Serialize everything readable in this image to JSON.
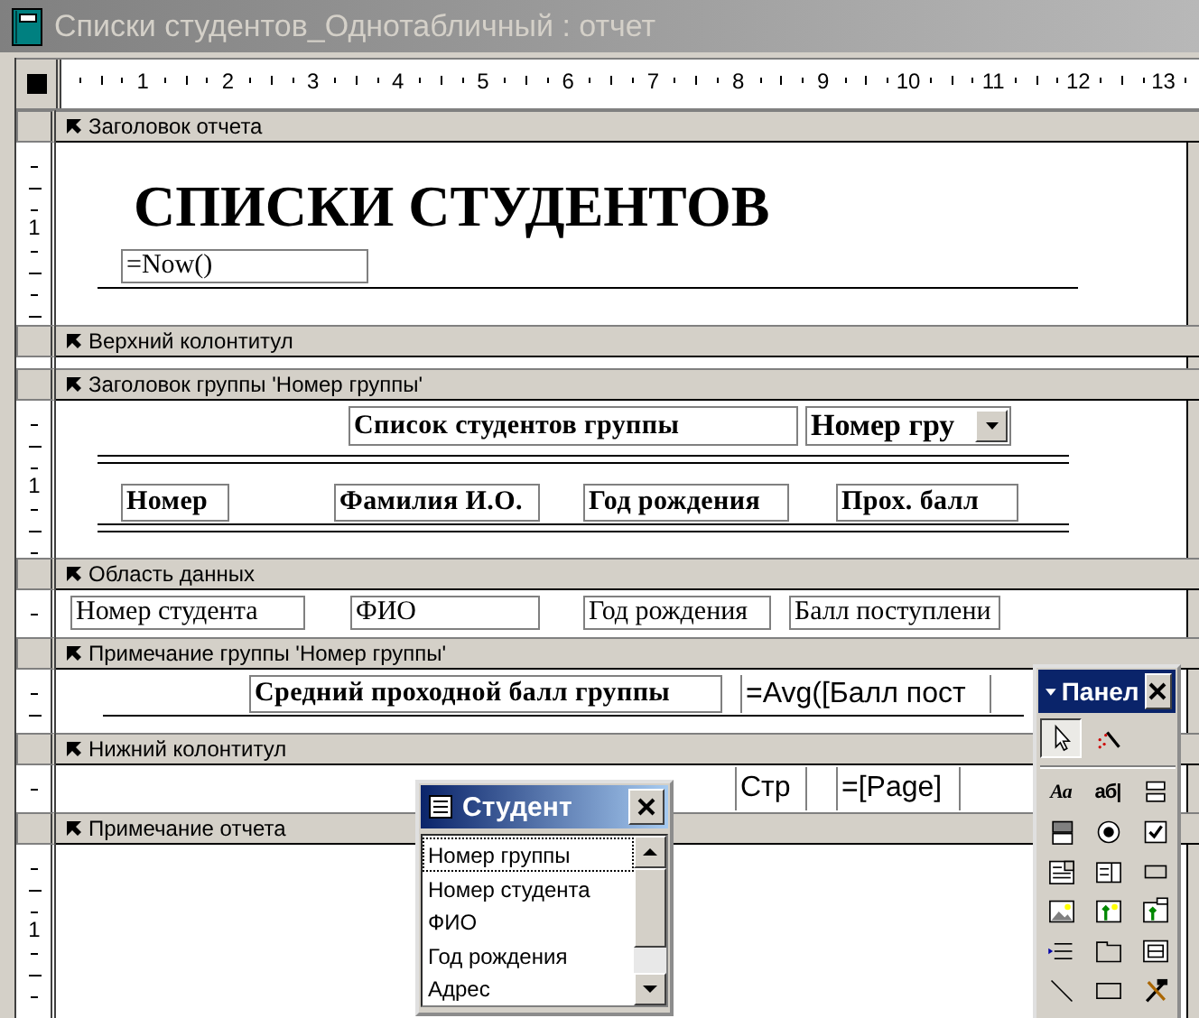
{
  "window": {
    "title": "Списки студентов_Однотабличный : отчет"
  },
  "ruler": {
    "labels": [
      "1",
      "2",
      "3",
      "4",
      "5",
      "6",
      "7",
      "8",
      "9",
      "10",
      "11",
      "12",
      "13"
    ]
  },
  "sections": [
    {
      "title": "Заголовок отчета",
      "ruler_label": "1",
      "controls": [
        {
          "kind": "heading",
          "text": "СПИСКИ СТУДЕНТОВ"
        },
        {
          "kind": "text_box",
          "text": "=Now()"
        }
      ]
    },
    {
      "title": "Верхний колонтитул"
    },
    {
      "title": "Заголовок группы 'Номер группы'",
      "ruler_label": "1",
      "controls": [
        {
          "kind": "bold_label",
          "text": "Список студентов группы"
        },
        {
          "kind": "combo_box",
          "text": "Номер гру"
        },
        {
          "kind": "bold_label",
          "text": "Номер"
        },
        {
          "kind": "bold_label",
          "text": "Фамилия И.О."
        },
        {
          "kind": "bold_label",
          "text": "Год рождения"
        },
        {
          "kind": "bold_label",
          "text": "Прох. балл"
        }
      ]
    },
    {
      "title": "Область данных",
      "controls": [
        {
          "kind": "text_box",
          "text": "Номер студента"
        },
        {
          "kind": "text_box",
          "text": "ФИО"
        },
        {
          "kind": "text_box",
          "text": "Год рождения"
        },
        {
          "kind": "text_box",
          "text": "Балл поступлени"
        }
      ]
    },
    {
      "title": "Примечание группы 'Номер группы'",
      "controls": [
        {
          "kind": "bold_label",
          "text": "Средний проходной балл группы"
        },
        {
          "kind": "sans_box",
          "text": "=Avg([Балл пост"
        }
      ]
    },
    {
      "title": "Нижний колонтитул",
      "controls": [
        {
          "kind": "sans_box",
          "text": "Стр"
        },
        {
          "kind": "sans_box",
          "text": "=[Page]"
        }
      ]
    },
    {
      "title": "Примечание отчета",
      "ruler_label": "1"
    }
  ],
  "field_list": {
    "title": "Студент",
    "items": [
      {
        "text": "Номер группы",
        "selected": true
      },
      {
        "text": "Номер студента",
        "selected": false
      },
      {
        "text": "ФИО",
        "selected": false
      },
      {
        "text": "Год рождения",
        "selected": false
      },
      {
        "text": "Адрес",
        "selected": false
      }
    ]
  },
  "toolbox": {
    "title": "Панел",
    "tools": [
      {
        "kind": "pointer",
        "selected": true
      },
      {
        "kind": "wizard",
        "selected": false
      },
      {
        "kind": "label",
        "text": "Aa",
        "selected": false
      },
      {
        "kind": "text_box",
        "text": "аб|",
        "selected": false
      },
      {
        "kind": "option_group",
        "selected": false
      },
      {
        "kind": "toggle",
        "selected": false
      },
      {
        "kind": "option_button",
        "selected": false
      },
      {
        "kind": "check_box",
        "selected": false
      },
      {
        "kind": "combo_box",
        "selected": false
      },
      {
        "kind": "list_box",
        "selected": false
      },
      {
        "kind": "command_button",
        "selected": false
      },
      {
        "kind": "image",
        "selected": false
      },
      {
        "kind": "unbound_frame",
        "selected": false
      },
      {
        "kind": "bound_frame",
        "selected": false
      },
      {
        "kind": "page_break",
        "selected": false
      },
      {
        "kind": "tab_control",
        "selected": false
      },
      {
        "kind": "subform",
        "selected": false
      },
      {
        "kind": "line",
        "selected": false
      },
      {
        "kind": "rectangle",
        "selected": false
      },
      {
        "kind": "more_tools",
        "selected": false
      }
    ]
  }
}
